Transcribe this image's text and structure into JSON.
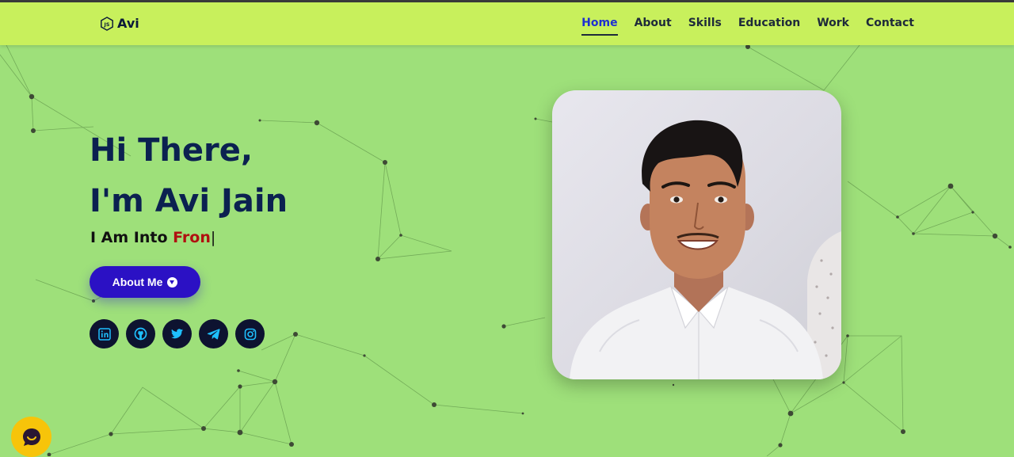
{
  "colors": {
    "background": "#9ee07a",
    "navbar": "#c8f05c",
    "heading": "#0b2150",
    "accent_button": "#2b11c4",
    "typed_text": "#b01010",
    "social_bg": "#0d1330",
    "social_icon": "#1ec0ff",
    "chat_button": "#f7c40a"
  },
  "navbar": {
    "logo_icon": "js-hexagon-icon",
    "logo_text": "Avi",
    "links": [
      {
        "label": "Home",
        "active": true
      },
      {
        "label": "About",
        "active": false
      },
      {
        "label": "Skills",
        "active": false
      },
      {
        "label": "Education",
        "active": false
      },
      {
        "label": "Work",
        "active": false
      },
      {
        "label": "Contact",
        "active": false
      }
    ]
  },
  "hero": {
    "greeting": "Hi There,",
    "name_line": "I'm Avi Jain",
    "subtitle_prefix": "I Am Into ",
    "typed_text": "Fron",
    "cursor": "|",
    "button_label": "About Me",
    "button_icon": "arrow-circle-down-icon",
    "socials": [
      {
        "name": "linkedin",
        "icon": "linkedin-icon"
      },
      {
        "name": "github",
        "icon": "github-icon"
      },
      {
        "name": "twitter",
        "icon": "twitter-icon"
      },
      {
        "name": "telegram",
        "icon": "telegram-icon"
      },
      {
        "name": "instagram",
        "icon": "instagram-icon"
      }
    ],
    "photo": "profile-photo"
  },
  "chat_widget": {
    "icon": "chat-bubble-icon"
  }
}
